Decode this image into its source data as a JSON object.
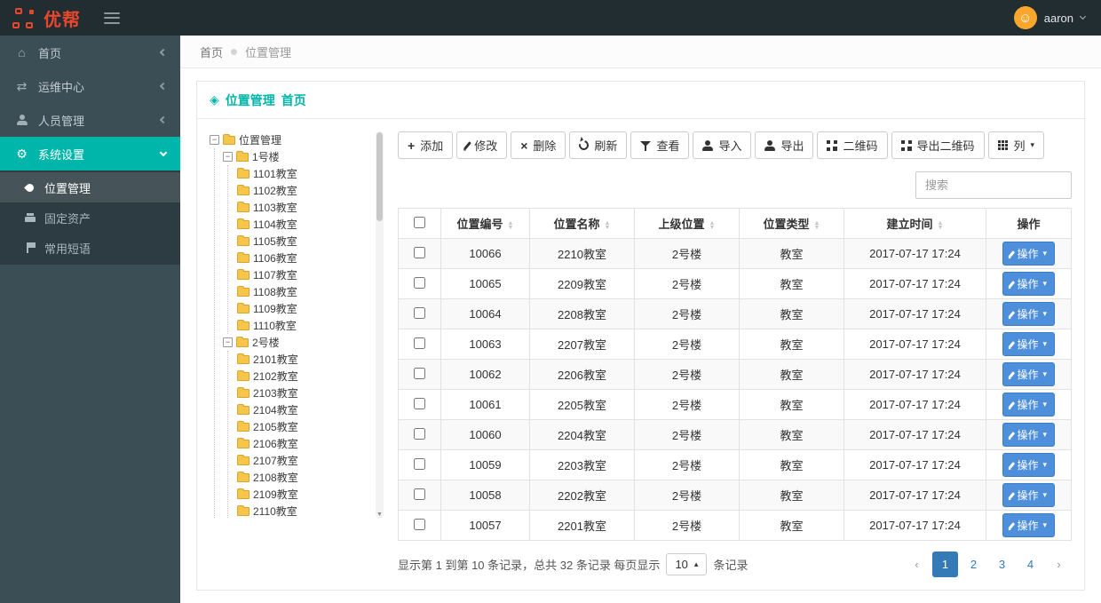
{
  "header": {
    "logo_text": "优帮",
    "user_name": "aaron"
  },
  "sidebar": {
    "items": [
      {
        "label": "首页"
      },
      {
        "label": "运维中心"
      },
      {
        "label": "人员管理"
      },
      {
        "label": "系统设置"
      }
    ],
    "subitems": [
      {
        "label": "位置管理"
      },
      {
        "label": "固定资产"
      },
      {
        "label": "常用短语"
      }
    ]
  },
  "breadcrumb": {
    "home": "首页",
    "current": "位置管理"
  },
  "panel": {
    "title": "位置管理",
    "subtitle": "首页"
  },
  "tree": {
    "root": "位置管理",
    "buildings": [
      {
        "name": "1号楼",
        "rooms": [
          "1101教室",
          "1102教室",
          "1103教室",
          "1104教室",
          "1105教室",
          "1106教室",
          "1107教室",
          "1108教室",
          "1109教室",
          "1110教室"
        ]
      },
      {
        "name": "2号楼",
        "rooms": [
          "2101教室",
          "2102教室",
          "2103教室",
          "2104教室",
          "2105教室",
          "2106教室",
          "2107教室",
          "2108教室",
          "2109教室",
          "2110教室"
        ]
      }
    ]
  },
  "toolbar": {
    "add": "添加",
    "edit": "修改",
    "delete": "删除",
    "refresh": "刷新",
    "view": "查看",
    "import": "导入",
    "export": "导出",
    "qrcode": "二维码",
    "export_qrcode": "导出二维码",
    "columns": "列"
  },
  "search": {
    "placeholder": "搜索"
  },
  "table": {
    "columns": [
      "位置编号",
      "位置名称",
      "上级位置",
      "位置类型",
      "建立时间",
      "操作"
    ],
    "action_label": "操作",
    "rows": [
      {
        "id": "10066",
        "name": "2210教室",
        "parent": "2号楼",
        "type": "教室",
        "created": "2017-07-17 17:24"
      },
      {
        "id": "10065",
        "name": "2209教室",
        "parent": "2号楼",
        "type": "教室",
        "created": "2017-07-17 17:24"
      },
      {
        "id": "10064",
        "name": "2208教室",
        "parent": "2号楼",
        "type": "教室",
        "created": "2017-07-17 17:24"
      },
      {
        "id": "10063",
        "name": "2207教室",
        "parent": "2号楼",
        "type": "教室",
        "created": "2017-07-17 17:24"
      },
      {
        "id": "10062",
        "name": "2206教室",
        "parent": "2号楼",
        "type": "教室",
        "created": "2017-07-17 17:24"
      },
      {
        "id": "10061",
        "name": "2205教室",
        "parent": "2号楼",
        "type": "教室",
        "created": "2017-07-17 17:24"
      },
      {
        "id": "10060",
        "name": "2204教室",
        "parent": "2号楼",
        "type": "教室",
        "created": "2017-07-17 17:24"
      },
      {
        "id": "10059",
        "name": "2203教室",
        "parent": "2号楼",
        "type": "教室",
        "created": "2017-07-17 17:24"
      },
      {
        "id": "10058",
        "name": "2202教室",
        "parent": "2号楼",
        "type": "教室",
        "created": "2017-07-17 17:24"
      },
      {
        "id": "10057",
        "name": "2201教室",
        "parent": "2号楼",
        "type": "教室",
        "created": "2017-07-17 17:24"
      }
    ]
  },
  "pagination": {
    "summary_prefix": "显示第 1 到第 10 条记录，总共 32 条记录 每页显示",
    "page_size": "10",
    "summary_suffix": "条记录",
    "prev": "‹",
    "next": "›",
    "pages": [
      "1",
      "2",
      "3",
      "4"
    ],
    "active_page": "1"
  },
  "colors": {
    "accent_teal": "#00b5a9",
    "brand_orange": "#e8472b",
    "action_blue": "#4e8fdb",
    "pagination_blue": "#337ab7"
  }
}
